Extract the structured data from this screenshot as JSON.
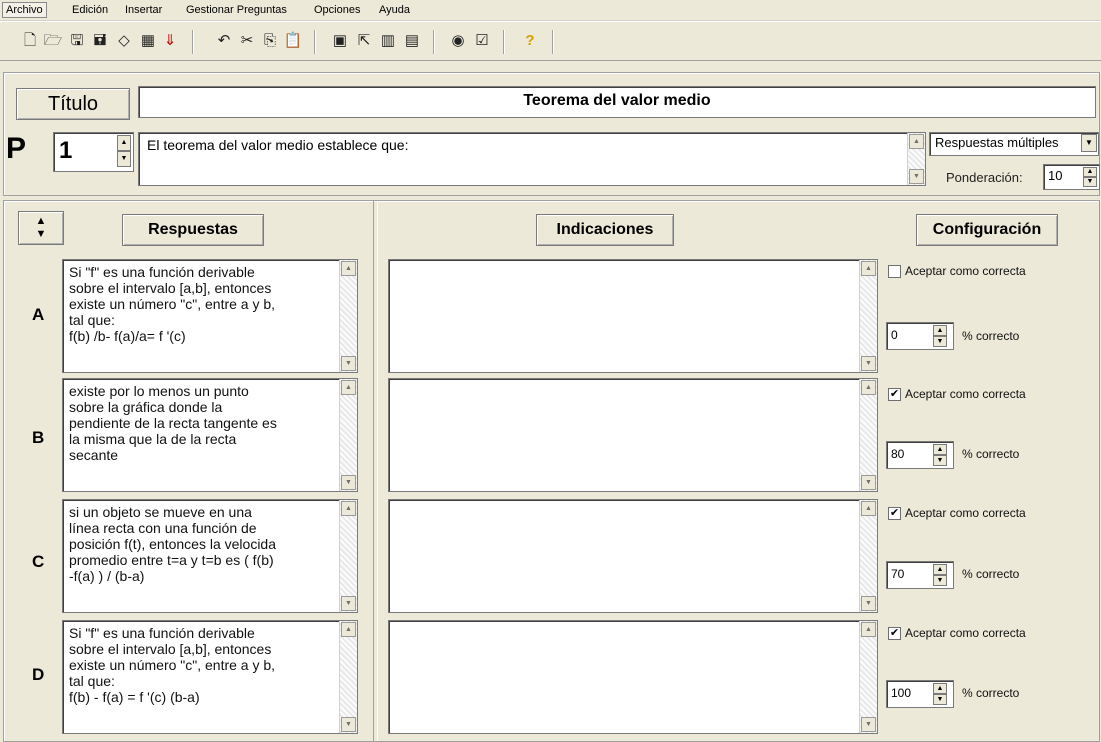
{
  "menu": [
    {
      "label": "Archivo"
    },
    {
      "label": "Edición"
    },
    {
      "label": "Insertar"
    },
    {
      "label": "Gestionar Preguntas"
    },
    {
      "label": "Opciones"
    },
    {
      "label": "Ayuda"
    }
  ],
  "toolbar": {
    "icons": [
      "new-document-icon",
      "open-folder-icon",
      "save-icon",
      "save-as-icon",
      "eraser-icon",
      "gallery-icon",
      "arrow-down-icon",
      "undo-icon",
      "cut-icon",
      "copy-icon",
      "paste-icon",
      "image-tool-icon",
      "export-icon",
      "tool-a-icon",
      "tool-b-icon",
      "preview-icon",
      "checklist-icon",
      "help-icon"
    ]
  },
  "header": {
    "title_button": "Título",
    "title_value": "Teorema del valor medio",
    "p_label": "P",
    "question_number": "1",
    "question_text": "El teorema del valor medio establece que:",
    "response_type": "Respuestas múltiples",
    "ponderacion_label": "Ponderación:",
    "ponderacion_value": "10"
  },
  "columns": {
    "answers": "Respuestas",
    "indications": "Indicaciones",
    "config": "Configuración"
  },
  "config_labels": {
    "accept": "Aceptar como correcta",
    "percent": "% correcto"
  },
  "answers": [
    {
      "letter": "A",
      "text": "Si \"f\" es una función derivable\nsobre el intervalo [a,b], entonces\nexiste un número \"c\", entre a y b,\ntal que:\nf(b) /b- f(a)/a= f '(c)",
      "accepted": false,
      "percent": "0"
    },
    {
      "letter": "B",
      "text": "existe por lo menos un punto\nsobre la gráfica donde la\npendiente de la recta tangente es\nla misma que la de la recta\nsecante",
      "accepted": true,
      "percent": "80"
    },
    {
      "letter": "C",
      "text": "si un objeto se mueve en una\nlínea recta con una función de\nposición f(t), entonces la velocida\npromedio entre t=a y t=b es ( f(b)\n-f(a) ) / (b-a)",
      "accepted": true,
      "percent": "70"
    },
    {
      "letter": "D",
      "text": "Si \"f\" es una función derivable\nsobre el intervalo [a,b], entonces\nexiste un número \"c\", entre a y b,\ntal que:\nf(b) - f(a) = f '(c) (b-a)",
      "accepted": true,
      "percent": "100"
    }
  ]
}
